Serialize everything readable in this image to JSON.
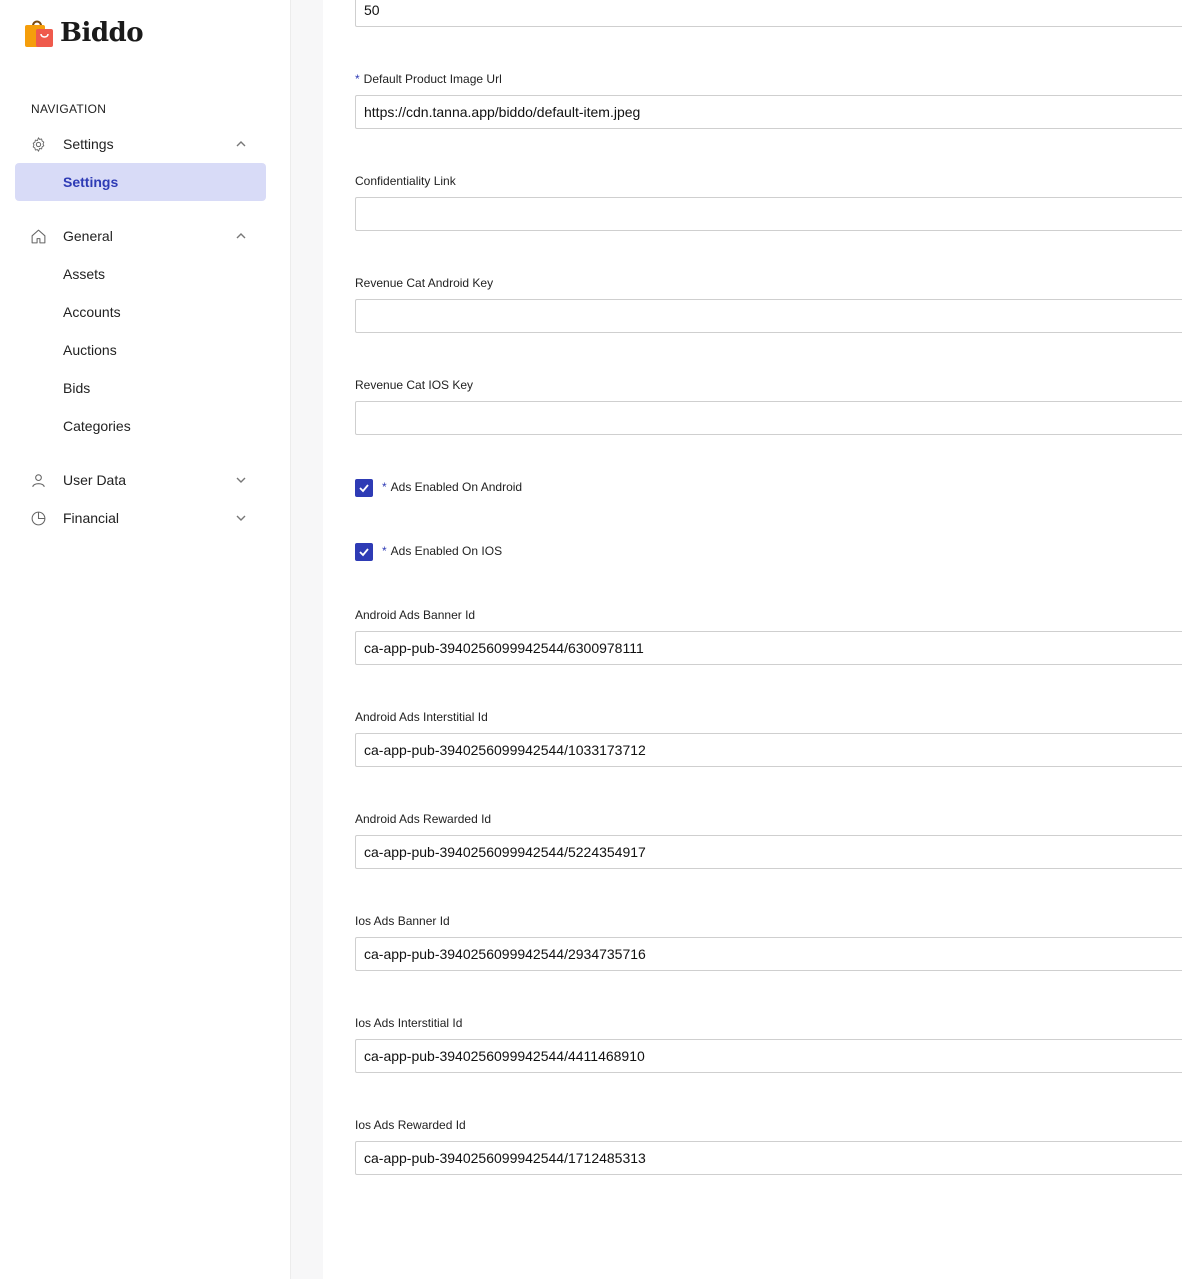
{
  "brand": {
    "name": "Biddo",
    "bag_color": "#f59e0b",
    "bag_accent": "#ef5a4c"
  },
  "sidebar": {
    "heading": "NAVIGATION",
    "groups": [
      {
        "label": "Settings",
        "icon": "gear-icon",
        "expanded": true,
        "items": [
          {
            "label": "Settings",
            "active": true
          }
        ]
      },
      {
        "label": "General",
        "icon": "home-icon",
        "expanded": true,
        "items": [
          {
            "label": "Assets"
          },
          {
            "label": "Accounts"
          },
          {
            "label": "Auctions"
          },
          {
            "label": "Bids"
          },
          {
            "label": "Categories"
          }
        ]
      },
      {
        "label": "User Data",
        "icon": "user-icon",
        "expanded": false
      },
      {
        "label": "Financial",
        "icon": "pie-chart-icon",
        "expanded": false
      }
    ]
  },
  "form": {
    "top_value": "50",
    "default_image": {
      "label": "Default Product Image Url",
      "required": true,
      "value": "https://cdn.tanna.app/biddo/default-item.jpeg"
    },
    "confidentiality": {
      "label": "Confidentiality Link",
      "value": ""
    },
    "revenue_cat_android": {
      "label": "Revenue Cat Android Key",
      "value": ""
    },
    "revenue_cat_ios": {
      "label": "Revenue Cat IOS Key",
      "value": ""
    },
    "ads_android": {
      "label": "Ads Enabled On Android",
      "required": true,
      "checked": true
    },
    "ads_ios": {
      "label": "Ads Enabled On IOS",
      "required": true,
      "checked": true
    },
    "android_banner": {
      "label": "Android Ads Banner Id",
      "value": "ca-app-pub-3940256099942544/6300978111"
    },
    "android_interstitial": {
      "label": "Android Ads Interstitial Id",
      "value": "ca-app-pub-3940256099942544/1033173712"
    },
    "android_rewarded": {
      "label": "Android Ads Rewarded Id",
      "value": "ca-app-pub-3940256099942544/5224354917"
    },
    "ios_banner": {
      "label": "Ios Ads Banner Id",
      "value": "ca-app-pub-3940256099942544/2934735716"
    },
    "ios_interstitial": {
      "label": "Ios Ads Interstitial Id",
      "value": "ca-app-pub-3940256099942544/4411468910"
    },
    "ios_rewarded": {
      "label": "Ios Ads Rewarded Id",
      "value": "ca-app-pub-3940256099942544/1712485313"
    }
  },
  "colors": {
    "accent": "#2e3bb5",
    "active_bg": "#d8dbf7",
    "gutter": "#f7f7f8"
  }
}
